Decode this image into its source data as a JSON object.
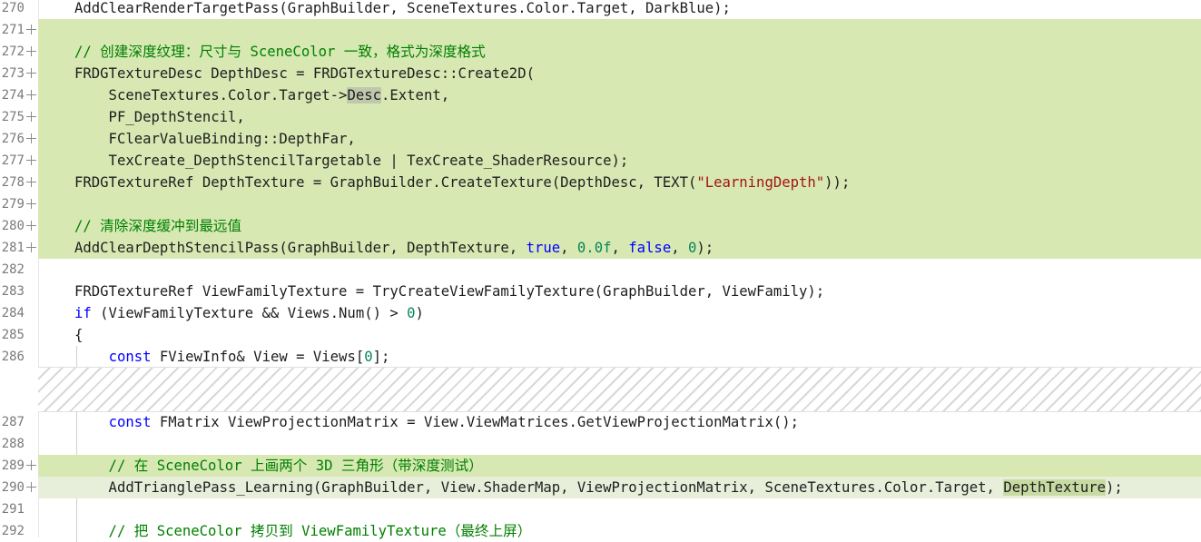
{
  "lines": [
    {
      "no": "270",
      "code": "AddClearRenderTargetPass(GraphBuilder, SceneTextures.Color.Target, DarkBlue);"
    },
    {
      "no": "271",
      "code": ""
    },
    {
      "no": "272",
      "comment": "// 创建深度纹理：尺寸与 SceneColor 一致，格式为深度格式"
    },
    {
      "no": "273",
      "code": "FRDGTextureDesc DepthDesc = FRDGTextureDesc::Create2D("
    },
    {
      "no": "274",
      "pre": "    SceneTextures.Color.Target->",
      "hl": "Desc",
      "post": ".Extent,"
    },
    {
      "no": "275",
      "code": "    PF_DepthStencil,"
    },
    {
      "no": "276",
      "code": "    FClearValueBinding::DepthFar,"
    },
    {
      "no": "277",
      "code": "    TexCreate_DepthStencilTargetable | TexCreate_ShaderResource);"
    },
    {
      "no": "278",
      "pre": "FRDGTextureRef DepthTexture = GraphBuilder.CreateTexture(DepthDesc, TEXT(",
      "str": "\"LearningDepth\"",
      "post": "));"
    },
    {
      "no": "279",
      "code": ""
    },
    {
      "no": "280",
      "comment": "// 清除深度缓冲到最远值"
    },
    {
      "no": "281",
      "pre": "AddClearDepthStencilPass(GraphBuilder, DepthTexture, ",
      "kw1": "true",
      ", ": ", ",
      "num1": "0.0f",
      "mid": ", ",
      "kw2": "false",
      "mid2": ", ",
      "num2": "0",
      "post": ");"
    },
    {
      "no": "282",
      "code": ""
    },
    {
      "no": "283",
      "code": "FRDGTextureRef ViewFamilyTexture = TryCreateViewFamilyTexture(GraphBuilder, ViewFamily);"
    },
    {
      "no": "284",
      "kw": "if",
      "rest": " (ViewFamilyTexture && Views.Num() > ",
      "num": "0",
      "post": ")"
    },
    {
      "no": "285",
      "code": "{"
    },
    {
      "no": "286",
      "kwind": "    ",
      "kw": "const",
      "rest": " FViewInfo& View = Views[",
      "num": "0",
      "post": "];"
    },
    {
      "no": "287",
      "kwind": "    ",
      "kw": "const",
      "rest": " FMatrix ViewProjectionMatrix = View.ViewMatrices.GetViewProjectionMatrix();"
    },
    {
      "no": "288",
      "code": ""
    },
    {
      "no": "289",
      "comment": "    // 在 SceneColor 上画两个 3D 三角形（带深度测试）"
    },
    {
      "no": "290",
      "pre": "    AddTrianglePass_Learning(GraphBuilder, View.ShaderMap, ViewProjectionMatrix, SceneTextures.Color.Target, ",
      "hl": "DepthTexture",
      "post": ");"
    },
    {
      "no": "291",
      "code": ""
    },
    {
      "no": "292",
      "comment": "    // 把 SceneColor 拷贝到 ViewFamilyTexture（最终上屏）"
    }
  ]
}
